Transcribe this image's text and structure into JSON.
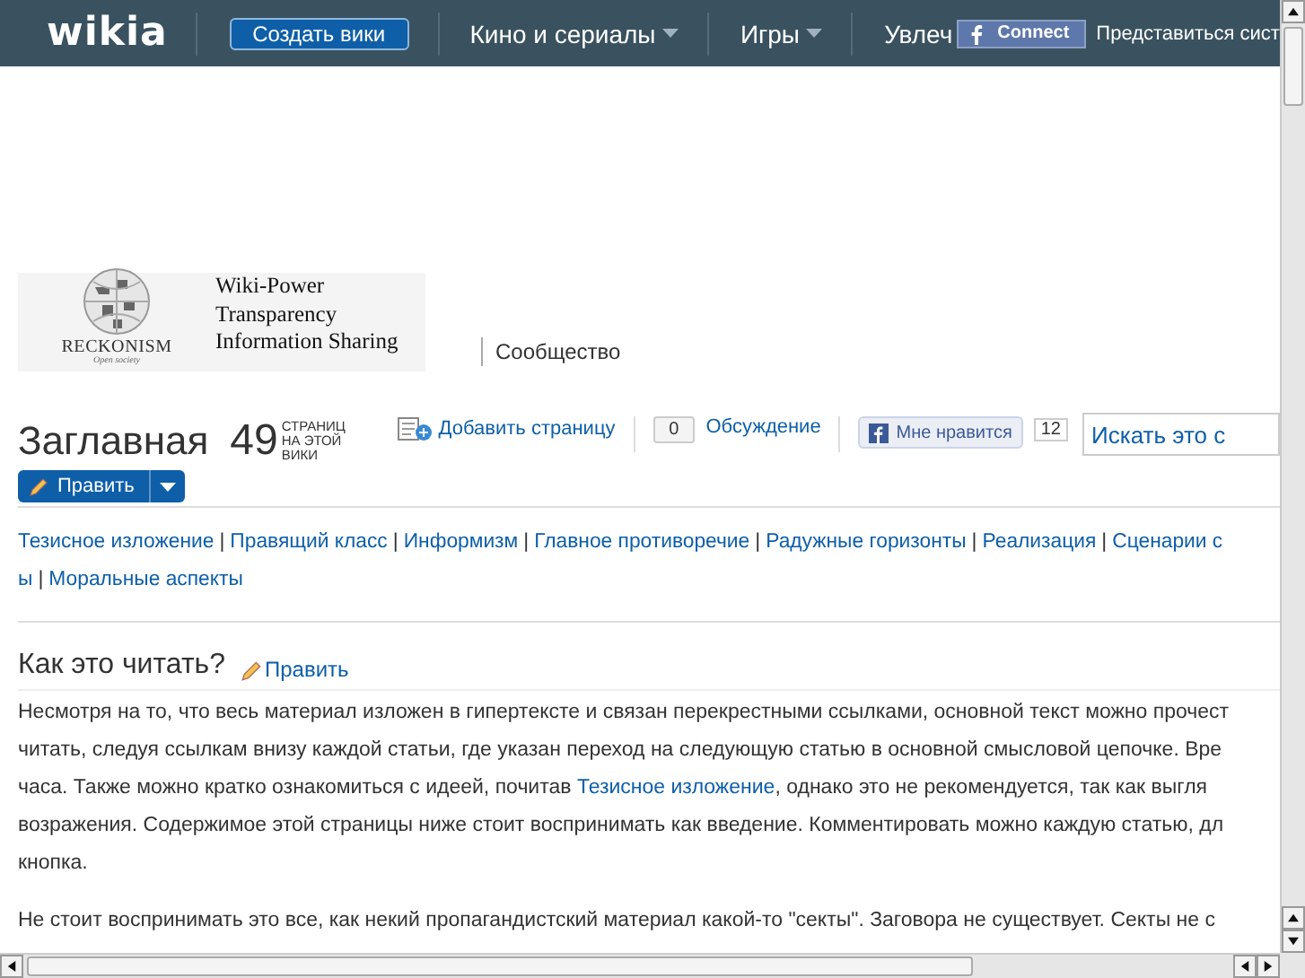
{
  "topbar": {
    "logo": "wikia",
    "create_button": "Создать вики",
    "menu": [
      {
        "label": "Кино и сериалы",
        "has_caret": true
      },
      {
        "label": "Игры",
        "has_caret": true
      },
      {
        "label": "Увлеч",
        "has_caret": false
      }
    ],
    "connect_button": "Connect",
    "login_link": "Представиться сист"
  },
  "wiki_header": {
    "logo_name": "RECKONISM",
    "logo_tagline": "Open society",
    "wordmark": [
      "Wiki-Power",
      "Transparency",
      "Information Sharing"
    ],
    "community_link": "Сообщество"
  },
  "page_header": {
    "title": "Заглавная",
    "page_count": "49",
    "page_count_label": [
      "СТРАНИЦ",
      "НА ЭТОЙ",
      "ВИКИ"
    ],
    "edit_button": "Править",
    "add_page": "Добавить страницу",
    "comments_count": "0",
    "discussion": "Обсуждение",
    "like_button": "Мне нравится",
    "like_count": "12",
    "search": {
      "placeholder": "Искать это с"
    }
  },
  "nav": {
    "separator": "|",
    "lines": [
      {
        "links": [
          "Тезисное изложение",
          "Правящий класс",
          "Информизм",
          "Главное противоречие",
          "Радужные горизонты",
          "Реализация",
          "Сценарии с"
        ]
      },
      {
        "links": [
          "ы",
          "Моральные аспекты"
        ]
      }
    ]
  },
  "section": {
    "heading": "Как это читать?",
    "edit_link": "Править",
    "lines": [
      {
        "segments": [
          {
            "text": "Несмотря на то, что весь материал изложен в гипертексте и связан перекрестными ссылками, основной текст можно прочест",
            "link": false
          }
        ]
      },
      {
        "segments": [
          {
            "text": "читать, следуя ссылкам внизу каждой статьи, где указан переход на следующую статью в основной смысловой цепочке. Вре",
            "link": false
          }
        ]
      },
      {
        "segments": [
          {
            "text": "часа. Также можно кратко ознакомиться с идеей, почитав ",
            "link": false
          },
          {
            "text": "Тезисное изложение",
            "link": true
          },
          {
            "text": ", однако это не рекомендуется, так как выгля",
            "link": false
          }
        ]
      },
      {
        "segments": [
          {
            "text": "возражения. Содержимое этой страницы ниже стоит воспринимать как введение. Комментировать можно каждую статью, дл",
            "link": false
          }
        ]
      },
      {
        "segments": [
          {
            "text": "кнопка.",
            "link": false
          }
        ]
      }
    ],
    "next_line": "Не стоит воспринимать это все, как некий пропагандистский материал какой-то \"секты\". Заговора не существует. Секты не с"
  }
}
